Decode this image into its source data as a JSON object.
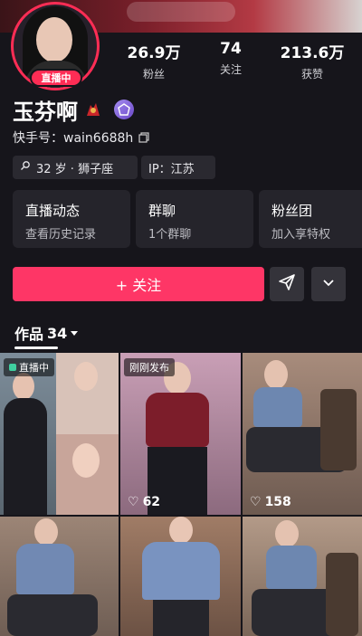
{
  "profile": {
    "live_badge": "直播中",
    "name": "玉芬啊",
    "kuaishou_id": "快手号：wain6688h",
    "age_sign": "32 岁 · 狮子座",
    "ip": "IP：江苏"
  },
  "stats": [
    {
      "value": "26.9万",
      "label": "粉丝"
    },
    {
      "value": "74",
      "label": "关注"
    },
    {
      "value": "213.6万",
      "label": "获赞"
    }
  ],
  "cards": [
    {
      "title": "直播动态",
      "sub": "查看历史记录"
    },
    {
      "title": "群聊",
      "sub": "1个群聊"
    },
    {
      "title": "粉丝团",
      "sub": "加入享特权"
    }
  ],
  "actions": {
    "follow": "+ 关注"
  },
  "works_tab": {
    "label": "作品",
    "count": "34"
  },
  "grid": [
    {
      "tag": "直播中",
      "likes": ""
    },
    {
      "tag": "刚刚发布",
      "likes": "62"
    },
    {
      "tag": "",
      "likes": "158"
    },
    {
      "tag": "",
      "likes": ""
    },
    {
      "tag": "",
      "likes": ""
    },
    {
      "tag": "",
      "likes": ""
    }
  ],
  "colors": {
    "accent": "#fe3666",
    "background": "#16151b",
    "card": "#25242b"
  }
}
